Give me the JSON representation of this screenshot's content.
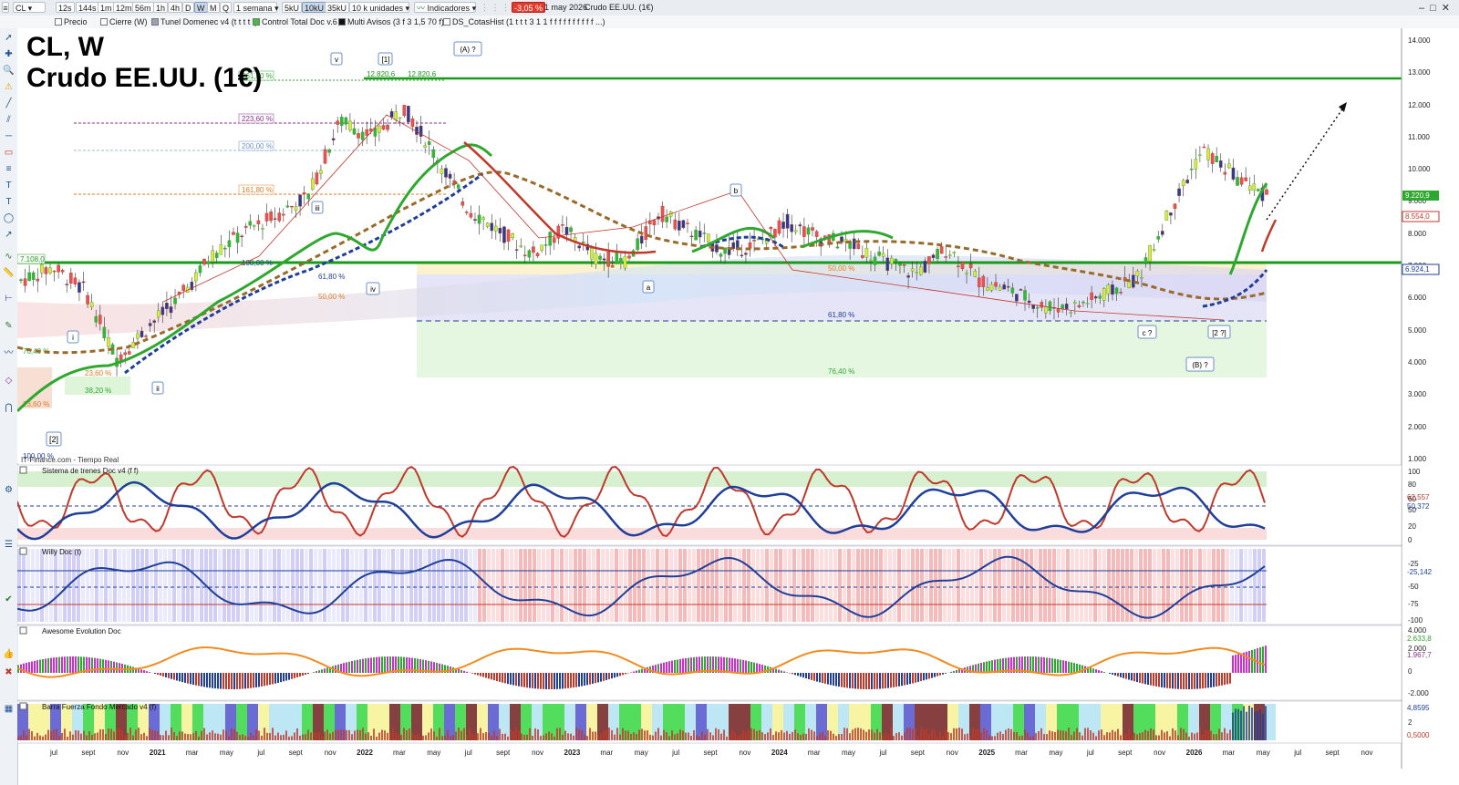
{
  "toolbar": {
    "symbol": "CL",
    "intervals": [
      "12s",
      "144s",
      "1m",
      "12m",
      "56m",
      "1h",
      "4h",
      "D",
      "W",
      "M",
      "Q"
    ],
    "active_interval": "W",
    "period": "1 semana",
    "units": [
      "5kU",
      "10kU",
      "35kU"
    ],
    "active_unit": "10kU",
    "unit_select": "10 k unidades",
    "indicators_label": "Indicadores",
    "change": "-3,05 %",
    "date": "1 may 2026",
    "instrument_name": "Crudo EE.UU. (1€)"
  },
  "studies": [
    {
      "label": "Precio",
      "color": "#ffffff"
    },
    {
      "label": "Cierre (W)",
      "color": "#ffffff"
    },
    {
      "label": "Tunel Domenec v4 (t t t t t)",
      "color": "#9aa3ad"
    },
    {
      "label": "Control Total Doc v.6",
      "color": "#46b946"
    },
    {
      "label": "Multi Avisos (3 f 3 1,5 70 f)",
      "color": "#111111"
    },
    {
      "label": "DS_CotasHist (1 t t t 3 1 1 f f f f f f f f f f ...)",
      "color": "#ffffff"
    }
  ],
  "chart": {
    "title_line1": "CL, W",
    "title_line2": "Crudo EE.UU. (1€)",
    "source": "IT-Finance.com - Tiempo Real",
    "price_axis": [
      "14.000",
      "13.000",
      "12.000",
      "11.000",
      "10.000",
      "9.000",
      "8.000",
      "7.000",
      "6.000",
      "5.000",
      "4.000",
      "3.000",
      "2.000",
      "1.000"
    ],
    "price_badges": [
      {
        "value": "9.220,9",
        "color": "#2fa82f"
      },
      {
        "value": "8.554,0",
        "color": "#c0392b"
      },
      {
        "value": "6.924,1",
        "color": "#1f3f99"
      }
    ],
    "level_label": "7.108,0",
    "high_labels": [
      "12.820,6",
      "12.820,6"
    ],
    "fib_labels": [
      {
        "text": "261,80 %",
        "color": "#2fa82f"
      },
      {
        "text": "223,60 %",
        "color": "#8e2c8e"
      },
      {
        "text": "200,00 %",
        "color": "#6b8fc7"
      },
      {
        "text": "161,80 %",
        "color": "#e07b20"
      },
      {
        "text": "100,00 %",
        "color": "#1f3f99"
      },
      {
        "text": "50,00 %",
        "color": "#e07b20"
      },
      {
        "text": "61,80 %",
        "color": "#1f3f99"
      },
      {
        "text": "76,40 %",
        "color": "#2fa82f"
      },
      {
        "text": "38,20 %",
        "color": "#2fa82f"
      },
      {
        "text": "23,60 %",
        "color": "#e07b20"
      },
      {
        "text": "61,80 %",
        "color": "#1f3f99"
      },
      {
        "text": "50,00 %",
        "color": "#e07b20"
      },
      {
        "text": "76,40 %",
        "color": "#2fa82f"
      },
      {
        "text": "23,60 %",
        "color": "#e07b20"
      },
      {
        "text": "100,00 %",
        "color": "#1f3f99"
      }
    ],
    "wave_labels": [
      "v",
      "[1]",
      "(A) ?",
      "iii",
      "iv",
      "i",
      "ii",
      "[2]",
      "b",
      "a",
      "c ?",
      "[2 ?]",
      "(B) ?"
    ],
    "series": {
      "trend": {
        "price": [
          6600,
          7000,
          6300,
          4200,
          5200,
          6100,
          7400,
          8100,
          8600,
          9200,
          11500,
          11000,
          11900,
          10400,
          8800,
          8100,
          7400,
          8200,
          7300,
          7200,
          8700,
          8100,
          7500,
          7700,
          8400,
          7900,
          7700,
          7200,
          6800,
          7600,
          6600,
          6300,
          5800,
          5800,
          6200,
          6700,
          8800,
          10600,
          9800,
          9200
        ]
      }
    }
  },
  "panels": [
    {
      "title": "Sistema de trenes Doc v4 (f f)",
      "axis": [
        "100",
        "80",
        "60",
        "50",
        "20",
        "0"
      ],
      "badges": [
        {
          "value": "62,557",
          "color": "#c0392b"
        },
        {
          "value": "50,372",
          "color": "#1f3f99"
        }
      ]
    },
    {
      "title": "Willy Doc (t)",
      "axis": [
        "-25",
        "-50",
        "-75",
        "-100"
      ],
      "badges": [
        {
          "value": "-25,142",
          "color": "#1f3f99"
        }
      ]
    },
    {
      "title": "Awesome Evolution Doc",
      "axis": [
        "4.000",
        "2.000",
        "0",
        "-2.000"
      ],
      "badges": [
        {
          "value": "2.633,8",
          "color": "#2fa82f"
        },
        {
          "value": "1.967,7",
          "color": "#8e2c8e"
        }
      ]
    },
    {
      "title": "Barra Fuerza Fondo Mercado v4 (f)",
      "axis": [
        "4,8595",
        "2",
        "0,5000"
      ],
      "badges": [
        {
          "value": "4,8595",
          "color": "#1f3f99"
        },
        {
          "value": "0,5000",
          "color": "#c0392b"
        }
      ]
    }
  ],
  "time_axis": [
    "jul",
    "sept",
    "nov",
    "2021",
    "mar",
    "may",
    "jul",
    "sept",
    "nov",
    "2022",
    "mar",
    "may",
    "jul",
    "sept",
    "nov",
    "2023",
    "mar",
    "may",
    "jul",
    "sept",
    "nov",
    "2024",
    "mar",
    "may",
    "jul",
    "sept",
    "nov",
    "2025",
    "mar",
    "may",
    "jul",
    "sept",
    "nov",
    "2026",
    "mar",
    "may",
    "jul",
    "sept",
    "nov"
  ],
  "colors": {
    "uptrend": "#2fa82f",
    "downtrend": "#c0392b",
    "support": "#1f3f99",
    "resistance": "#1a9a1a",
    "accent": "#e23b2e"
  },
  "icons": [
    "pointer-icon",
    "crosshair-icon",
    "zoom-icon",
    "trendline-icon",
    "text-icon",
    "fibonacci-icon",
    "ruler-icon",
    "settings-icon"
  ]
}
